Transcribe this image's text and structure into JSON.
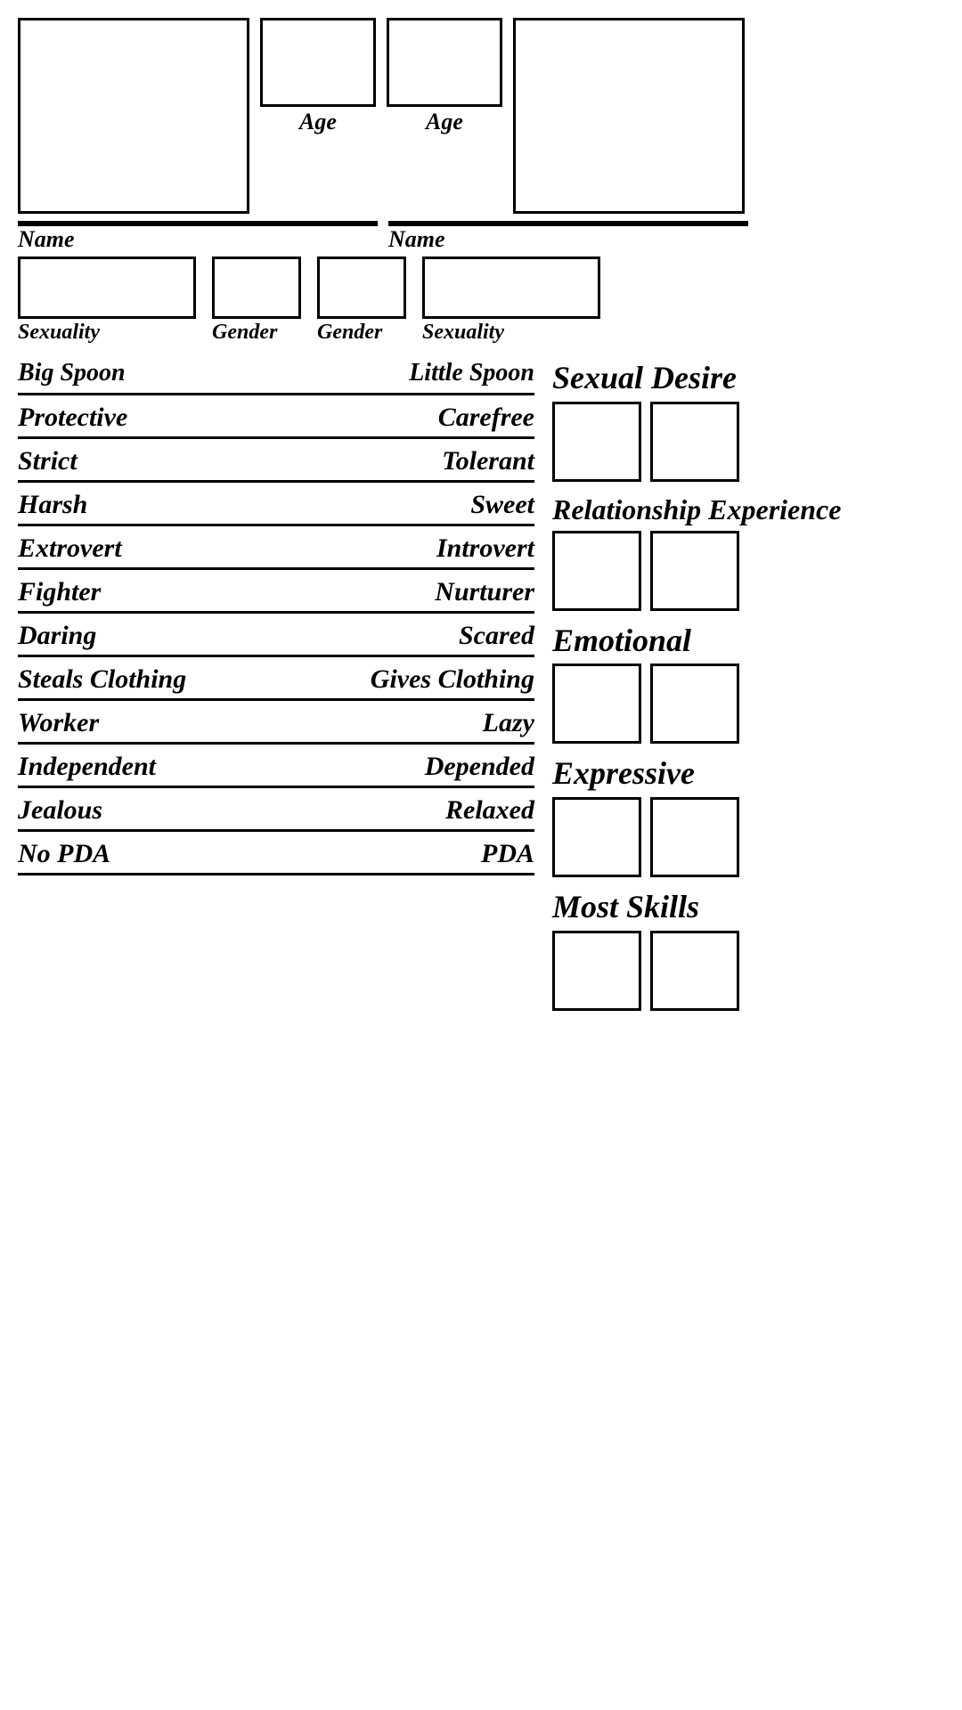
{
  "header": {
    "age_label_left": "Age",
    "age_label_right": "Age",
    "name_label_left": "Name",
    "name_label_right": "Name",
    "sexuality_label_left": "Sexuality",
    "gender_label_left": "Gender",
    "gender_label_right": "Gender",
    "sexuality_label_right": "Sexuality"
  },
  "spoon": {
    "big": "Big Spoon",
    "little": "Little Spoon"
  },
  "traits": [
    {
      "left": "Protective",
      "right": "Carefree"
    },
    {
      "left": "Strict",
      "right": "Tolerant"
    },
    {
      "left": "Harsh",
      "right": "Sweet"
    },
    {
      "left": "Extrovert",
      "right": "Introvert"
    },
    {
      "left": "Fighter",
      "right": "Nurturer"
    },
    {
      "left": "Daring",
      "right": "Scared"
    },
    {
      "left": "Steals Clothing",
      "right": "Gives Clothing"
    },
    {
      "left": "Worker",
      "right": "Lazy"
    },
    {
      "left": "Independent",
      "right": "Depended"
    },
    {
      "left": "Jealous",
      "right": "Relaxed"
    },
    {
      "left": "No PDA",
      "right": "PDA"
    }
  ],
  "right_panel": {
    "sexual_desire_title": "Sexual Desire",
    "relationship_experience_title": "Relationship Experience",
    "emotional_title": "Emotional",
    "expressive_title": "Expressive",
    "most_skills_title": "Most Skills"
  }
}
